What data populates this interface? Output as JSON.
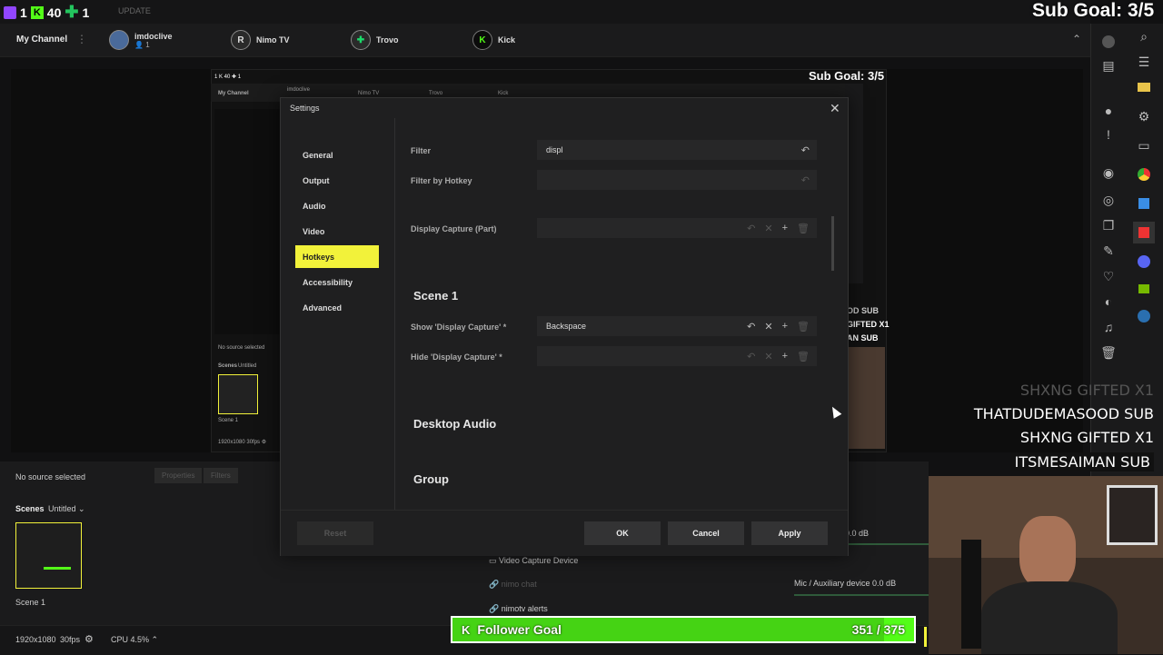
{
  "overlay": {
    "top_left_prefix": "1",
    "top_left_count": "40",
    "top_left_suffix": "1",
    "faded_text": "UPDATE",
    "sub_goal": "Sub Goal: 3/5"
  },
  "channels": {
    "label": "My Channel",
    "items": [
      {
        "name": "imdoclive",
        "sub": "1",
        "initial": "",
        "style": "avatar"
      },
      {
        "name": "Nimo TV",
        "initial": "R",
        "style": "nimo"
      },
      {
        "name": "Trovo",
        "initial": "✚",
        "style": "trovo"
      },
      {
        "name": "Kick",
        "initial": "K",
        "style": "kick"
      }
    ]
  },
  "inner": {
    "my_channel": "My Channel",
    "channel_1": "imdoclive",
    "channel_2": "Nimo TV",
    "channel_3": "Trovo",
    "channel_4": "Kick",
    "sub_goal": "Sub Goal: 3/5",
    "no_source": "No source selected",
    "scenes": "Scenes",
    "untitled": "Untitled",
    "scene_1": "Scene 1",
    "resolution": "1920x1080",
    "fps": "30fps",
    "feed_1": "OD SUB",
    "feed_2": "GIFTED X1",
    "feed_3": "AN SUB"
  },
  "feed": [
    {
      "user": "SHXNG",
      "event": "GIFTED X1"
    },
    {
      "user": "THATDUDEMASOOD",
      "event": "SUB"
    },
    {
      "user": "SHXNG",
      "event": "GIFTED X1"
    },
    {
      "user": "ITSMESAIMAN",
      "event": "SUB"
    }
  ],
  "lower": {
    "no_source": "No source selected",
    "properties": "Properties",
    "filters": "Filters",
    "scenes": "Scenes",
    "untitled": "Untitled",
    "scene_1": "Scene 1",
    "source_1": "Video Capture Device",
    "source_2": "nimo chat",
    "source_3": "nimotv alerts",
    "mixer_1_level": "0.0 dB",
    "mixer_2_label": "Mic / Auxiliary device",
    "mixer_2_level": "0.0 dB"
  },
  "status": {
    "resolution": "1920x1080",
    "fps": "30fps",
    "cpu": "CPU 4.5%"
  },
  "settings": {
    "title": "Settings",
    "nav": [
      "General",
      "Output",
      "Audio",
      "Video",
      "Hotkeys",
      "Accessibility",
      "Advanced"
    ],
    "active_nav": "Hotkeys",
    "filter_label": "Filter",
    "filter_value": "displ",
    "filter_hotkey_label": "Filter by Hotkey",
    "display_capture_part": "Display Capture (Part)",
    "scene_heading": "Scene 1",
    "show_label": "Show 'Display Capture' *",
    "show_value": "Backspace",
    "hide_label": "Hide 'Display Capture' *",
    "desktop_audio": "Desktop Audio",
    "group": "Group",
    "reset": "Reset",
    "ok": "OK",
    "cancel": "Cancel",
    "apply": "Apply"
  },
  "follower_goal": {
    "label": "Follower Goal",
    "current": 351,
    "target": 375,
    "text": "351 / 375"
  },
  "colors": {
    "accent_yellow": "#f2f23a",
    "kick_green": "#53fc18",
    "twitch_purple": "#9146ff"
  }
}
